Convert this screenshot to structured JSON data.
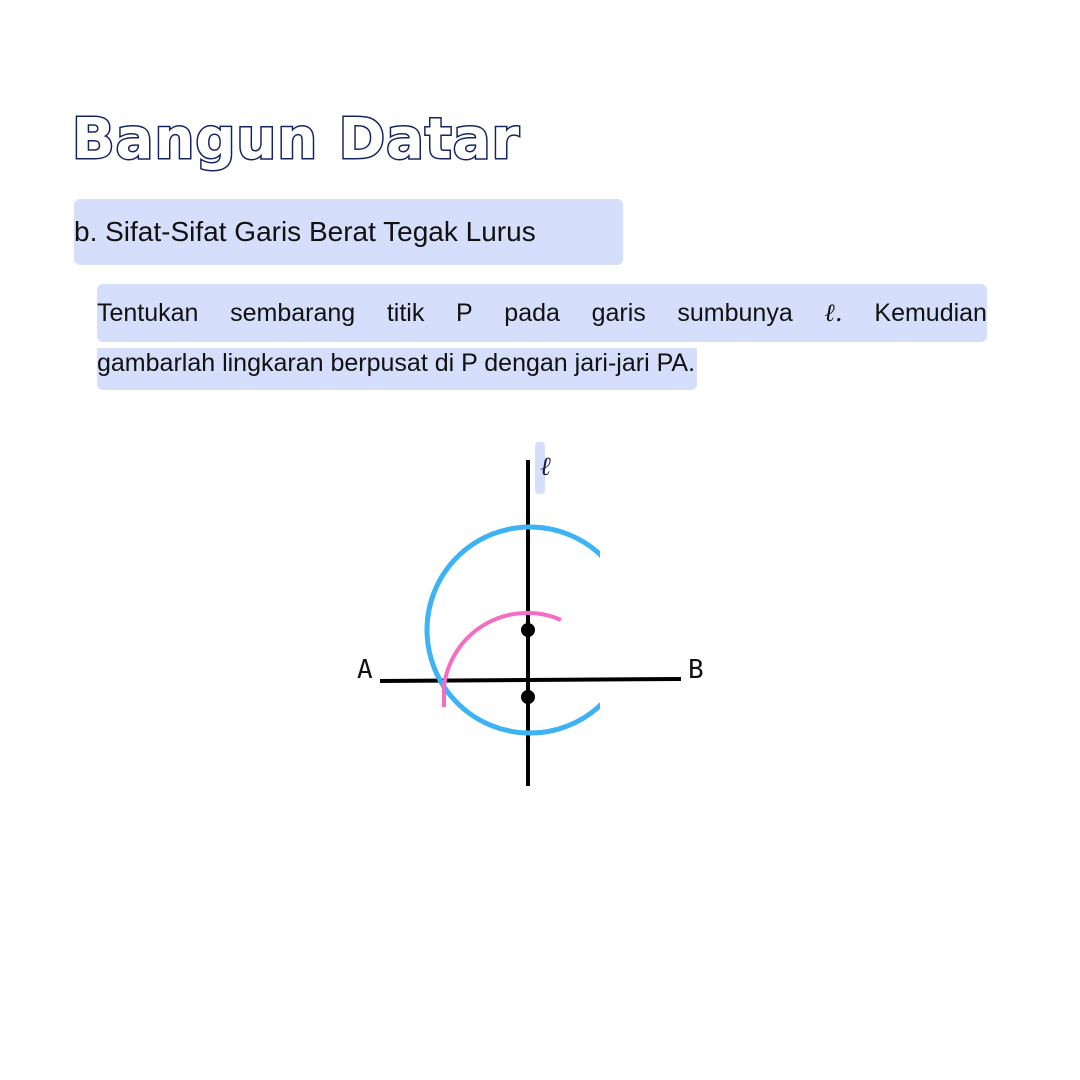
{
  "title": "Bangun Datar",
  "subheading": "b. Sifat-Sifat Garis Berat Tegak Lurus",
  "instruction": {
    "line1_words": [
      "Tentukan",
      "sembarang",
      "titik",
      "P",
      "pada",
      "garis",
      "sumbunya",
      "ℓ.",
      "Kemudian"
    ],
    "line2": "gambarlah lingkaran berpusat di P dengan jari-jari PA."
  },
  "diagram": {
    "axis_label": "ℓ",
    "point_a_label": "A",
    "point_b_label": "B",
    "colors": {
      "line": "#000000",
      "big_circle": "#3db3f5",
      "small_arc": "#f56cc4",
      "highlight": "#d5defa",
      "title_stroke": "#15245e"
    }
  }
}
